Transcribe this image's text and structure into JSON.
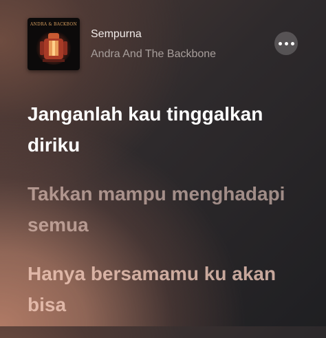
{
  "now_playing": {
    "album_art": {
      "icon": "album-cover",
      "cover_text": "ANDRA & BACKBONE"
    },
    "title": "Sempurna",
    "artist": "Andra And The Backbone",
    "more_icon": "ellipsis-icon"
  },
  "lyrics": {
    "lines": [
      {
        "text": "Janganlah kau tinggalkan diriku",
        "state": "active"
      },
      {
        "text": "Takkan mampu menghadapi semua",
        "state": "upcoming"
      },
      {
        "text": "Hanya bersamamu ku akan bisa",
        "state": "upcoming"
      }
    ]
  },
  "colors": {
    "active_lyric": "#ffffff",
    "upcoming_lyric": "#e8c8bc",
    "title": "#f2ecea",
    "artist": "#a89f9c"
  }
}
